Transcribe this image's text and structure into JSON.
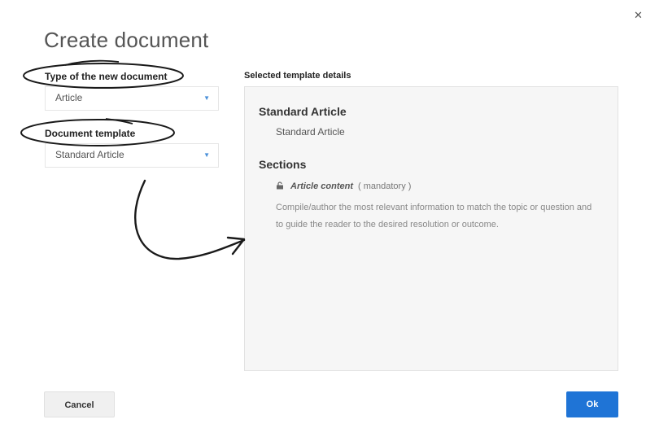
{
  "dialog": {
    "title": "Create document",
    "close_icon": "close-icon"
  },
  "type_field": {
    "label": "Type of the new document",
    "value": "Article",
    "icon": "chevron-down-icon"
  },
  "template_field": {
    "label": "Document template",
    "value": "Standard Article",
    "icon": "chevron-down-icon"
  },
  "details": {
    "label": "Selected template details",
    "template_name": "Standard Article",
    "template_description": "Standard Article",
    "sections_heading": "Sections",
    "sections": [
      {
        "icon": "lock-icon",
        "name": "Article content",
        "status": "( mandatory )",
        "description": "Compile/author the most relevant information to match the topic or question and to guide the reader to the desired resolution or outcome."
      }
    ]
  },
  "buttons": {
    "cancel": "Cancel",
    "ok": "Ok"
  },
  "colors": {
    "primary": "#1f74d6",
    "panel_bg": "#f6f6f6",
    "annotation": "#1a1a1a"
  }
}
